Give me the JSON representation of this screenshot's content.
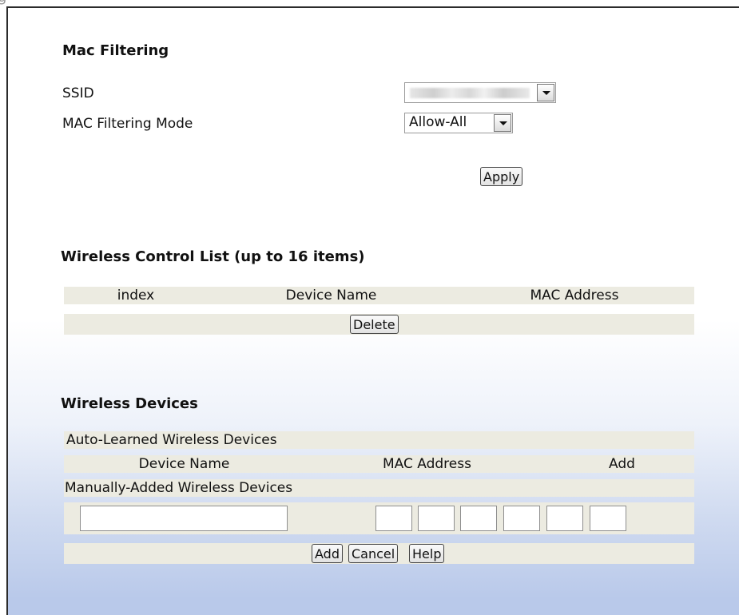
{
  "mac_filtering": {
    "heading": "Mac Filtering",
    "ssid_label": "SSID",
    "ssid_value": "",
    "mode_label": "MAC Filtering Mode",
    "mode_value": "Allow-All",
    "apply_label": "Apply"
  },
  "control_list": {
    "heading": "Wireless Control List (up to 16 items)",
    "columns": [
      "index",
      "Device Name",
      "MAC Address"
    ],
    "delete_label": "Delete"
  },
  "wireless_devices": {
    "heading": "Wireless Devices",
    "auto_learned_label": "Auto-Learned Wireless Devices",
    "columns": [
      "Device Name",
      "MAC Address",
      "Add"
    ],
    "manual_label": "Manually-Added Wireless Devices",
    "device_name_value": "",
    "mac_octets": [
      "",
      "",
      "",
      "",
      "",
      ""
    ],
    "buttons": {
      "add": "Add",
      "cancel": "Cancel",
      "help": "Help"
    }
  }
}
